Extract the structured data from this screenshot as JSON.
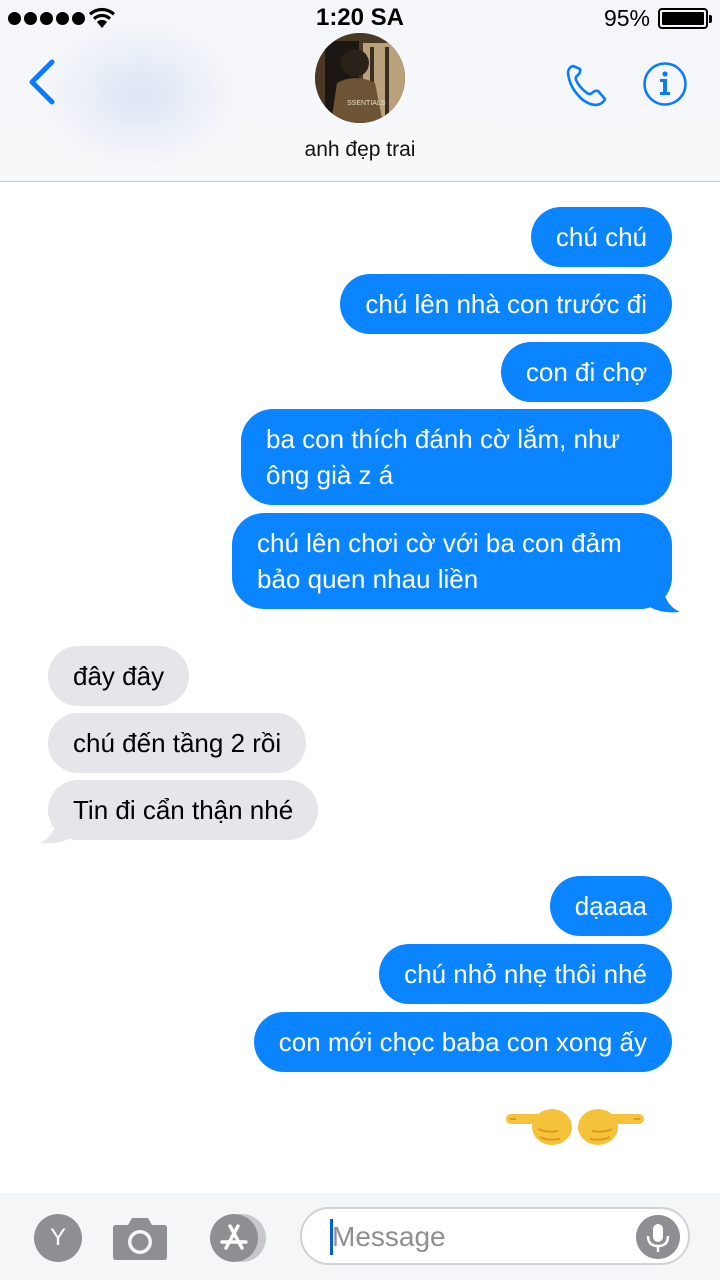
{
  "status_bar": {
    "time": "1:20 SA",
    "battery": "95%"
  },
  "header": {
    "contact_name": "anh đẹp trai",
    "avatar_text": "SSENTIALS"
  },
  "messages": [
    {
      "dir": "out",
      "text": "chú chú"
    },
    {
      "dir": "out",
      "text": "chú lên nhà con trước đi"
    },
    {
      "dir": "out",
      "text": "con đi chợ"
    },
    {
      "dir": "out",
      "text": "ba con thích đánh cờ lắm, như ông già z á"
    },
    {
      "dir": "out",
      "text": "chú lên chơi cờ với ba con đảm bảo quen nhau liền"
    },
    {
      "dir": "in",
      "text": "đây đây"
    },
    {
      "dir": "in",
      "text": "chú đến tầng 2 rồi"
    },
    {
      "dir": "in",
      "text": "Tin đi cẩn thận nhé"
    },
    {
      "dir": "out",
      "text": "dạaaa"
    },
    {
      "dir": "out",
      "text": "chú nhỏ nhẹ thôi nhé"
    },
    {
      "dir": "out",
      "text": "con mới chọc baba con xong ấy"
    }
  ],
  "emoji_message": {
    "icons": [
      "pointing-left-hand-icon",
      "pointing-right-hand-icon"
    ]
  },
  "toolbar": {
    "apps_label": "Y",
    "input_placeholder": "Message",
    "icons": [
      "camera-icon",
      "app-store-icon",
      "microphone-icon"
    ]
  },
  "colors": {
    "outgoing": "#0a84ff",
    "incoming": "#e5e5ea",
    "accent": "#0a7aff"
  }
}
